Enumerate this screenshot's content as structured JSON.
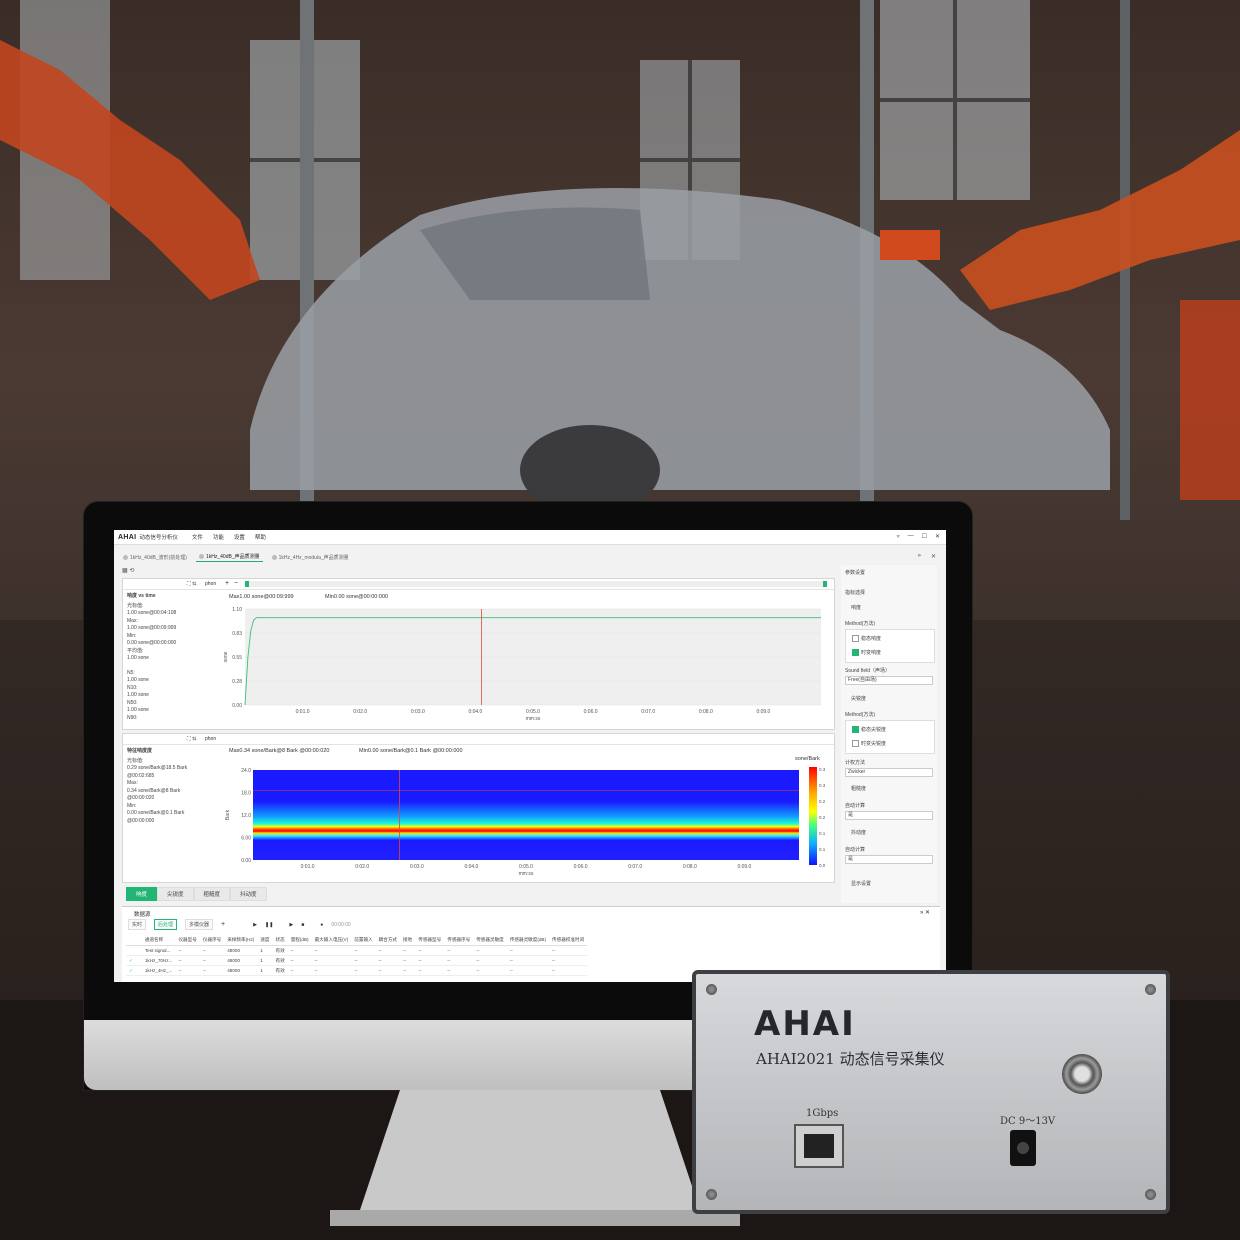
{
  "app": {
    "logo": "AHAI",
    "title": "动态信号分析仪",
    "menu": [
      "文件",
      "功能",
      "设置",
      "帮助"
    ],
    "window_buttons": [
      "▿",
      "—",
      "☐",
      "✕"
    ]
  },
  "tabs": [
    {
      "label": "1kHz_40dB_波形(前处理)",
      "active": false
    },
    {
      "label": "1kHz_40dB_声品质测量",
      "active": true
    },
    {
      "label": "1kHz_4Hz_modula_声品质测量",
      "active": false
    }
  ],
  "chart1": {
    "header_unit": "phon",
    "info_title": "响度 vs time",
    "info_lines": [
      "光标值:",
      "1.00 sone@00:04:108",
      "Max:",
      "1.00 sone@00:09:999",
      "Min:",
      "0.00 sone@00:00:000",
      "平均值:",
      "1.00 sone",
      "",
      "N5:",
      "1.00 sone",
      "N10:",
      "1.00 sone",
      "N50:",
      "1.00 sone",
      "N90:"
    ],
    "max_label": "Max1.00 sone@00:09:999",
    "min_label": "Min0.00 sone@00:00:000"
  },
  "chart2": {
    "header_unit": "phon",
    "info_title": "特征响度度",
    "info_lines": [
      "光标值:",
      "0.29 sone/Bark@18.5 Bark",
      "@00:02:685",
      "Max:",
      "0.34 sone/Bark@8 Bark",
      "@00:00:020",
      "Min:",
      "0.00 sone/Bark@0.1 Bark",
      "@00:00:000"
    ],
    "max_label": "Max0.34 sone/Bark@8 Bark @00:00:020",
    "min_label": "Min0.00 sone/Bark@0.1 Bark @00:00:000",
    "colorbar_title": "sone/Bark"
  },
  "chart_data": [
    {
      "type": "line",
      "title": "响度 vs time",
      "ylabel": "sone",
      "xlabel": "mm:ss",
      "ylim": [
        0,
        1.1
      ],
      "yticks": [
        "1.10",
        "0.83",
        "0.55",
        "0.28",
        "0.00"
      ],
      "xticks": [
        "0:01.0",
        "0:02.0",
        "0:03.0",
        "0:04.0",
        "0:05.0",
        "0:06.0",
        "0:07.0",
        "0:08.0",
        "0:09.0"
      ],
      "series": [
        {
          "x": [
            0,
            0.05,
            0.1,
            0.15,
            0.2,
            0.3,
            0.5,
            1,
            2,
            3,
            4,
            5,
            6,
            7,
            8,
            9,
            10
          ],
          "values": [
            0,
            0.55,
            0.85,
            0.97,
            1.0,
            1.0,
            1.0,
            1.0,
            1.0,
            1.0,
            1.0,
            1.0,
            1.0,
            1.0,
            1.0,
            1.0,
            1.0
          ]
        }
      ],
      "cursor_x": 4.108,
      "line_color": "#3cbf7a"
    },
    {
      "type": "heatmap",
      "title": "特征响度度",
      "ylabel": "Bark",
      "xlabel": "mm:ss",
      "ylim": [
        0,
        24
      ],
      "yticks": [
        "24.0",
        "18.0",
        "12.0",
        "6.00",
        "0.00"
      ],
      "xticks": [
        "0:01.0",
        "0:02.0",
        "0:03.0",
        "0:04.0",
        "0:05.0",
        "0:06.0",
        "0:07.0",
        "0:08.0",
        "0:09.0"
      ],
      "colorbar_ticks": [
        "0.3",
        "0.3",
        "0.2",
        "0.2",
        "0.1",
        "0.1",
        "0.0"
      ],
      "cursor_x": 2.685,
      "cursor_y": 18.5
    }
  ],
  "bottom_tabs": [
    {
      "label": "响度",
      "active": true
    },
    {
      "label": "尖锐度",
      "active": false
    },
    {
      "label": "粗糙度",
      "active": false
    },
    {
      "label": "抖动度",
      "active": false
    }
  ],
  "settings": {
    "title": "参数设置",
    "section1": "指标选择",
    "loudness": "响度",
    "method_label": "Method(方法)",
    "method_opts": [
      {
        "label": "稳态响度",
        "on": false
      },
      {
        "label": "时变响度",
        "on": true
      }
    ],
    "sound_field_label": "Sound field（声场）",
    "sound_field_value": "Free(自由场)",
    "sharpness": "尖锐度",
    "method2_label": "Method(方法)",
    "method2_opts": [
      {
        "label": "稳态尖锐度",
        "on": true
      },
      {
        "label": "时变尖锐度",
        "on": false
      }
    ],
    "calc_label": "计权方法",
    "calc_value": "Zwicker",
    "roughness": "粗糙度",
    "auto1_label": "自动计算",
    "auto1_value": "是",
    "fluct": "抖动度",
    "auto2_label": "自动计算",
    "auto2_value": "是",
    "display": "显示设置"
  },
  "data_panel": {
    "title": "数据源",
    "buttons": [
      {
        "label": "实时",
        "on": false
      },
      {
        "label": "后处理",
        "on": true
      },
      {
        "label": "多模仪器",
        "on": false
      }
    ],
    "time": "00:00:00",
    "headers": [
      "",
      "",
      "通道名称",
      "仪器型号",
      "仪器序号",
      "采样频率(Hz)",
      "速度",
      "状态",
      "量程(dB)",
      "最大输入电压(V)",
      "前置输入",
      "耦合方式",
      "接地",
      "传感器型号",
      "传感器序号",
      "传感器灵敏度",
      "传感器灵敏度(dB)",
      "传感器校准时间"
    ],
    "rows": [
      [
        "",
        "",
        "Test signal...",
        "--",
        "--",
        "48000",
        "1",
        "有效",
        "--",
        "--",
        "--",
        "--",
        "--",
        "--",
        "--",
        "--",
        "--",
        "--"
      ],
      [
        "✓",
        "",
        "1kHz_70Hz...",
        "--",
        "--",
        "48000",
        "1",
        "有效",
        "--",
        "--",
        "--",
        "--",
        "--",
        "--",
        "--",
        "--",
        "--",
        "--"
      ],
      [
        "✓",
        "",
        "1kHz_4Hz_...",
        "--",
        "--",
        "48000",
        "1",
        "有效",
        "--",
        "--",
        "--",
        "--",
        "--",
        "--",
        "--",
        "--",
        "--",
        "--"
      ]
    ]
  },
  "device": {
    "brand": "AHAI",
    "model": "AHAI2021 动态信号采集仪",
    "port_label": "1Gbps",
    "power_label": "DC 9～13V"
  }
}
